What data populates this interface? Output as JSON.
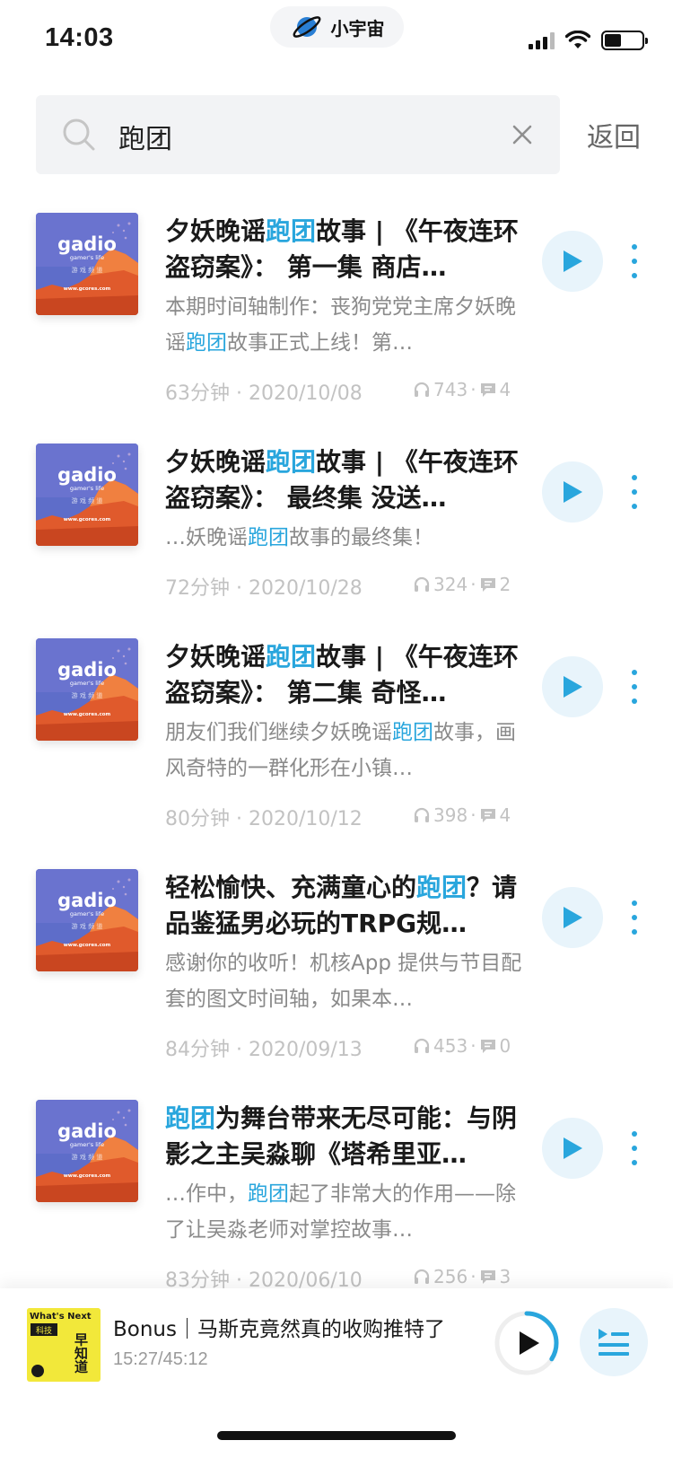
{
  "status_bar": {
    "time": "14:03",
    "brand": "小宇宙"
  },
  "search": {
    "query": "跑团",
    "back_label": "返回"
  },
  "colors": {
    "accent": "#29a6dd",
    "accent_bg": "#e8f4fb"
  },
  "cover": {
    "brand": "gadio",
    "tagline": "gamer's life",
    "channel": "游 戏 频 道",
    "url": "www.gcores.com"
  },
  "episodes": [
    {
      "title_parts": [
        "夕妖晚谣",
        "跑团",
        "故事 | 《午夜连环盗窃案》： 第一集 商店…"
      ],
      "desc_parts": [
        "本期时间轴制作：丧狗党党主席夕妖晚谣",
        "跑团",
        "故事正式上线！第…"
      ],
      "duration": "63分钟",
      "date": "2020/10/08",
      "plays": "743",
      "comments": "4"
    },
    {
      "title_parts": [
        "夕妖晚谣",
        "跑团",
        "故事 | 《午夜连环盗窃案》： 最终集 没送…"
      ],
      "desc_parts": [
        "…妖晚谣",
        "跑团",
        "故事的最终集！"
      ],
      "duration": "72分钟",
      "date": "2020/10/28",
      "plays": "324",
      "comments": "2"
    },
    {
      "title_parts": [
        "夕妖晚谣",
        "跑团",
        "故事 | 《午夜连环盗窃案》： 第二集 奇怪…"
      ],
      "desc_parts": [
        "朋友们我们继续夕妖晚谣",
        "跑团",
        "故事，画风奇特的一群化形在小镇…"
      ],
      "duration": "80分钟",
      "date": "2020/10/12",
      "plays": "398",
      "comments": "4"
    },
    {
      "title_parts": [
        "轻松愉快、充满童心的",
        "跑团",
        "？请品鉴猛男必玩的TRPG规…"
      ],
      "desc_parts": [
        "感谢你的收听！机核App 提供与节目配套的图文时间轴，如果本…",
        "",
        ""
      ],
      "duration": "84分钟",
      "date": "2020/09/13",
      "plays": "453",
      "comments": "0"
    },
    {
      "title_parts": [
        "",
        "跑团",
        "为舞台带来无尽可能：与阴影之主吴淼聊《塔希里亚…"
      ],
      "desc_parts": [
        "…作中，",
        "跑团",
        "起了非常大的作用——除了让吴淼老师对掌控故事…"
      ],
      "duration": "83分钟",
      "date": "2020/06/10",
      "plays": "256",
      "comments": "3"
    }
  ],
  "meta_separator": " · ",
  "player": {
    "title": "Bonus｜马斯克竟然真的收购推特了",
    "time": "15:27/45:12",
    "progress": 0.34,
    "cover_top": "What's Next",
    "cover_tag": "科技",
    "cover_main": "早知道"
  }
}
